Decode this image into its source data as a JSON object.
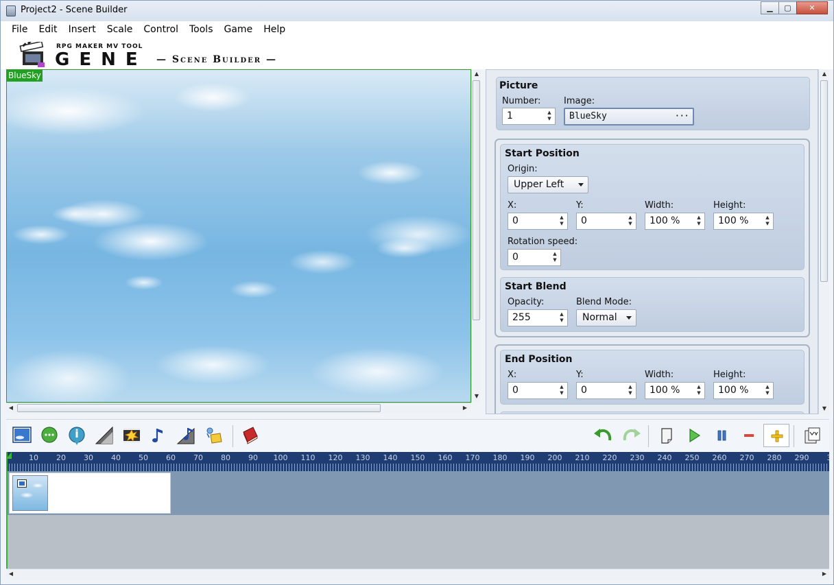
{
  "window": {
    "title": "Project2 - Scene Builder",
    "controls": {
      "minimize": "▁",
      "maximize": "▢",
      "close": "✕"
    }
  },
  "menu": [
    "File",
    "Edit",
    "Insert",
    "Scale",
    "Control",
    "Tools",
    "Game",
    "Help"
  ],
  "logo": {
    "small": "RPG MAKER MV TOOL",
    "main": "GENE",
    "sub": "— Scene Builder —"
  },
  "preview": {
    "tag": "BlueSky"
  },
  "picture": {
    "title": "Picture",
    "number_label": "Number:",
    "number_value": "1",
    "image_label": "Image:",
    "image_value": "BlueSky",
    "image_button": "···"
  },
  "start_position": {
    "title": "Start Position",
    "origin_label": "Origin:",
    "origin_value": "Upper Left",
    "x_label": "X:",
    "x_value": "0",
    "y_label": "Y:",
    "y_value": "0",
    "width_label": "Width:",
    "width_value": "100 %",
    "height_label": "Height:",
    "height_value": "100 %",
    "rotation_label": "Rotation speed:",
    "rotation_value": "0"
  },
  "start_blend": {
    "title": "Start Blend",
    "opacity_label": "Opacity:",
    "opacity_value": "255",
    "blend_label": "Blend Mode:",
    "blend_value": "Normal"
  },
  "end_position": {
    "title": "End Position",
    "x_label": "X:",
    "x_value": "0",
    "y_label": "Y:",
    "y_value": "0",
    "width_label": "Width:",
    "width_value": "100 %",
    "height_label": "Height:",
    "height_value": "100 %"
  },
  "toolbar": {
    "left_icons": [
      "picture-icon",
      "speech-bubble-icon",
      "info-drop-icon",
      "wipe-gradient-icon",
      "film-flash-icon",
      "music-note-icon",
      "music-ramp-icon",
      "sound-effect-icon",
      "book-icon"
    ],
    "right_icons": [
      "undo-icon",
      "redo-icon",
      "new-page-icon",
      "play-icon",
      "pause-icon",
      "zoom-out-icon",
      "zoom-in-icon",
      "export-mv-icon"
    ]
  },
  "timeline": {
    "ruler": [
      "10",
      "20",
      "30",
      "40",
      "50",
      "60",
      "70",
      "80",
      "90",
      "100",
      "110",
      "120",
      "130",
      "140",
      "150",
      "160",
      "170",
      "180",
      "190",
      "200",
      "210",
      "220",
      "230",
      "240",
      "250",
      "260",
      "270",
      "280",
      "290",
      "3"
    ]
  },
  "colors": {
    "accent_green": "#21a021",
    "ruler_bg": "#1f3d72",
    "track_bg": "#8198b3",
    "panel_group": "#c9d6e7"
  }
}
